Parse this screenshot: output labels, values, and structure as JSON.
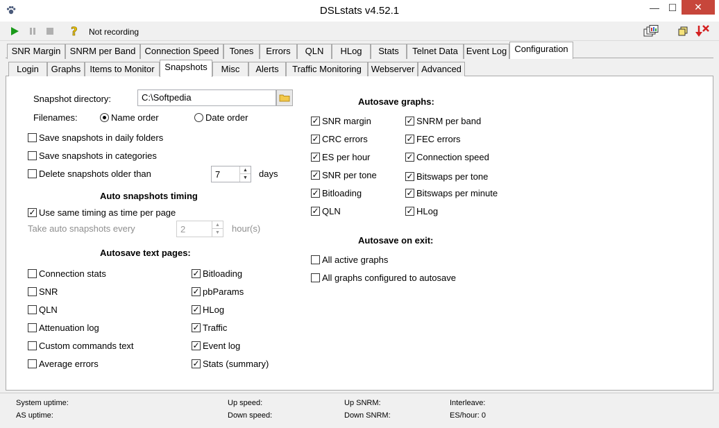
{
  "window": {
    "title": "DSLstats v4.52.1"
  },
  "toolbar": {
    "status": "Not recording"
  },
  "main_tabs": [
    "SNR Margin",
    "SNRM per Band",
    "Connection Speed",
    "Tones",
    "Errors",
    "QLN",
    "HLog",
    "Stats",
    "Telnet Data",
    "Event Log",
    "Configuration"
  ],
  "sub_tabs": [
    "Login",
    "Graphs",
    "Items to Monitor",
    "Snapshots",
    "Misc",
    "Alerts",
    "Traffic Monitoring",
    "Webserver",
    "Advanced"
  ],
  "snapshots": {
    "dir_label": "Snapshot directory:",
    "dir_value": "C:\\Softpedia",
    "filenames_label": "Filenames:",
    "radio_name": "Name order",
    "radio_date": "Date order",
    "daily_folders": "Save snapshots in daily folders",
    "categories": "Save snapshots in categories",
    "delete_older": "Delete snapshots older than",
    "days_value": "7",
    "days_unit": "days",
    "timing_header": "Auto snapshots timing",
    "same_timing": "Use same timing as time per page",
    "take_every": "Take auto snapshots every",
    "hours_value": "2",
    "hours_unit": "hour(s)",
    "text_pages_header": "Autosave text pages:",
    "text_left": [
      {
        "label": "Connection stats",
        "checked": false
      },
      {
        "label": "SNR",
        "checked": false
      },
      {
        "label": "QLN",
        "checked": false
      },
      {
        "label": "Attenuation log",
        "checked": false
      },
      {
        "label": "Custom commands text",
        "checked": false
      },
      {
        "label": "Average errors",
        "checked": false
      }
    ],
    "text_right": [
      {
        "label": "Bitloading",
        "checked": true
      },
      {
        "label": "pbParams",
        "checked": true
      },
      {
        "label": "HLog",
        "checked": true
      },
      {
        "label": "Traffic",
        "checked": true
      },
      {
        "label": "Event log",
        "checked": true
      },
      {
        "label": "Stats (summary)",
        "checked": true
      }
    ],
    "graphs_header": "Autosave graphs:",
    "graphs_left": [
      {
        "label": "SNR margin",
        "checked": true
      },
      {
        "label": "CRC errors",
        "checked": true
      },
      {
        "label": "ES per hour",
        "checked": true
      },
      {
        "label": "SNR per tone",
        "checked": true
      },
      {
        "label": "Bitloading",
        "checked": true
      },
      {
        "label": "QLN",
        "checked": true
      }
    ],
    "graphs_right": [
      {
        "label": "SNRM per band",
        "checked": true
      },
      {
        "label": "FEC errors",
        "checked": true
      },
      {
        "label": "Connection speed",
        "checked": true
      },
      {
        "label": "Bitswaps per tone",
        "checked": true
      },
      {
        "label": "Bitswaps per minute",
        "checked": true
      },
      {
        "label": "HLog",
        "checked": true
      }
    ],
    "exit_header": "Autosave on exit:",
    "exit_all_active": "All active graphs",
    "exit_all_configured": "All graphs configured to autosave"
  },
  "statusbar": {
    "system_uptime": "System uptime:",
    "as_uptime": "AS uptime:",
    "up_speed": "Up speed:",
    "down_speed": "Down speed:",
    "up_snrm": "Up SNRM:",
    "down_snrm": "Down SNRM:",
    "interleave": "Interleave:",
    "es_hour": "ES/hour: 0"
  },
  "colors": {
    "play": "#1a9a1a",
    "close": "#c7463b",
    "accent_red": "#d42020"
  }
}
